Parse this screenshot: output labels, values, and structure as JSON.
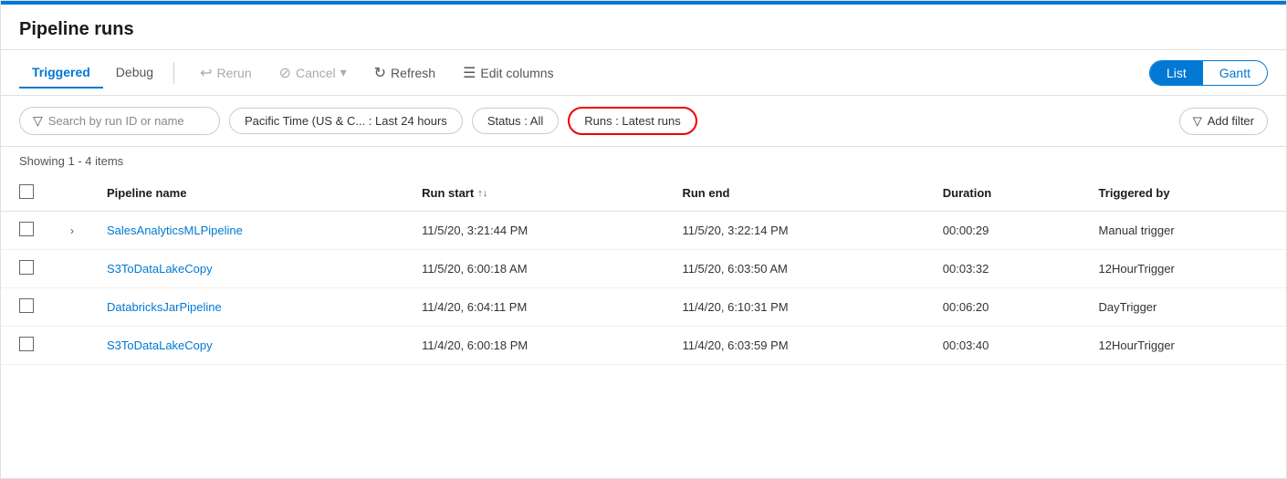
{
  "page": {
    "title": "Pipeline runs",
    "topbar_color": "#0078d4"
  },
  "toolbar": {
    "tabs": [
      {
        "label": "Triggered",
        "active": true
      },
      {
        "label": "Debug",
        "active": false
      }
    ],
    "actions": [
      {
        "label": "Rerun",
        "icon": "↩",
        "disabled": true
      },
      {
        "label": "Cancel",
        "icon": "⊘",
        "disabled": true,
        "has_dropdown": true
      },
      {
        "label": "Refresh",
        "icon": "↻",
        "disabled": false
      }
    ],
    "edit_columns_label": "Edit columns",
    "view_toggle": {
      "list_label": "List",
      "gantt_label": "Gantt",
      "active": "List"
    }
  },
  "filters": {
    "search_placeholder": "Search by run ID or name",
    "time_filter": "Pacific Time (US & C... : Last 24 hours",
    "status_filter": "Status : All",
    "runs_filter": "Runs : Latest runs",
    "add_filter_label": "Add filter"
  },
  "table": {
    "showing_text": "Showing 1 - 4 items",
    "columns": [
      {
        "label": "Pipeline name",
        "sortable": false
      },
      {
        "label": "Run start",
        "sortable": true
      },
      {
        "label": "Run end",
        "sortable": false
      },
      {
        "label": "Duration",
        "sortable": false
      },
      {
        "label": "Triggered by",
        "sortable": false
      }
    ],
    "rows": [
      {
        "name": "SalesAnalyticsMLPipeline",
        "run_start": "11/5/20, 3:21:44 PM",
        "run_end": "11/5/20, 3:22:14 PM",
        "duration": "00:00:29",
        "triggered_by": "Manual trigger",
        "expandable": true
      },
      {
        "name": "S3ToDataLakeCopy",
        "run_start": "11/5/20, 6:00:18 AM",
        "run_end": "11/5/20, 6:03:50 AM",
        "duration": "00:03:32",
        "triggered_by": "12HourTrigger",
        "expandable": false
      },
      {
        "name": "DatabricksJarPipeline",
        "run_start": "11/4/20, 6:04:11 PM",
        "run_end": "11/4/20, 6:10:31 PM",
        "duration": "00:06:20",
        "triggered_by": "DayTrigger",
        "expandable": false
      },
      {
        "name": "S3ToDataLakeCopy",
        "run_start": "11/4/20, 6:00:18 PM",
        "run_end": "11/4/20, 6:03:59 PM",
        "duration": "00:03:40",
        "triggered_by": "12HourTrigger",
        "expandable": false
      }
    ]
  }
}
